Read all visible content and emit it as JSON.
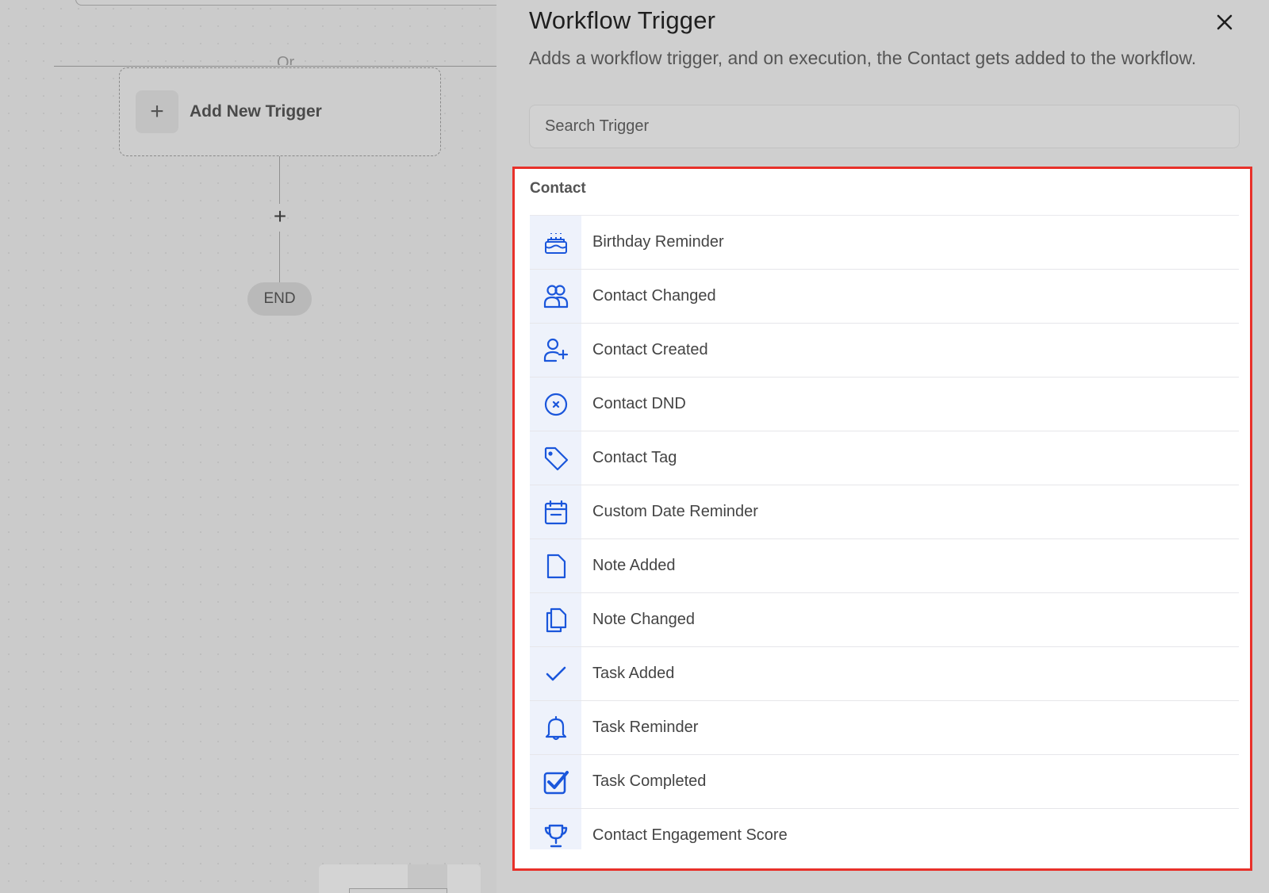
{
  "canvas": {
    "or_text": "Or",
    "add_trigger_label": "Add New Trigger",
    "add_trigger_icon": "plus-icon",
    "add_step_icon": "plus-icon",
    "end_label": "END"
  },
  "drawer": {
    "title": "Workflow Trigger",
    "close_icon": "close-icon",
    "description": "Adds a workflow trigger, and on execution, the Contact gets added to the workflow.",
    "search_placeholder": "Search Trigger",
    "section_title": "Contact",
    "accent_color": "#1a56db",
    "highlight_color": "#e8312a",
    "items": [
      {
        "label": "Birthday Reminder",
        "icon": "birthday-cake-icon"
      },
      {
        "label": "Contact Changed",
        "icon": "users-icon"
      },
      {
        "label": "Contact Created",
        "icon": "user-plus-icon"
      },
      {
        "label": "Contact DND",
        "icon": "x-circle-icon"
      },
      {
        "label": "Contact Tag",
        "icon": "tag-icon"
      },
      {
        "label": "Custom Date Reminder",
        "icon": "calendar-icon"
      },
      {
        "label": "Note Added",
        "icon": "file-icon"
      },
      {
        "label": "Note Changed",
        "icon": "files-icon"
      },
      {
        "label": "Task Added",
        "icon": "check-icon"
      },
      {
        "label": "Task Reminder",
        "icon": "bell-icon"
      },
      {
        "label": "Task Completed",
        "icon": "check-square-icon"
      },
      {
        "label": "Contact Engagement Score",
        "icon": "trophy-icon"
      }
    ]
  }
}
